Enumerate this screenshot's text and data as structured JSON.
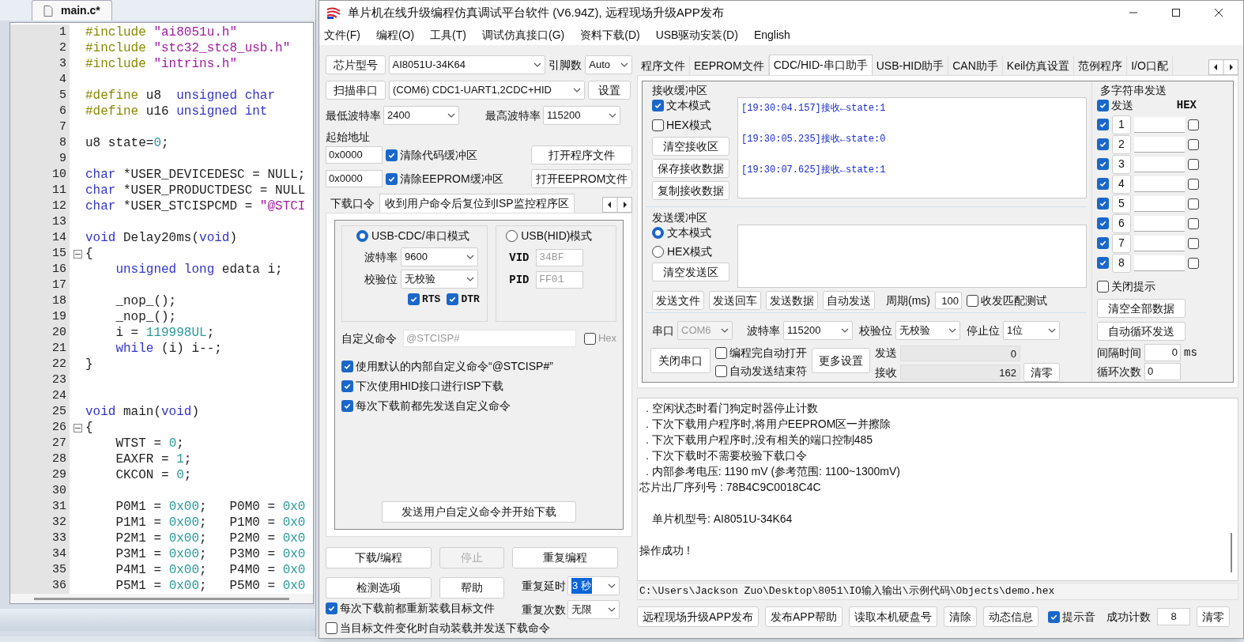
{
  "editor": {
    "tab": "main.c*",
    "lines": [
      {
        "number": "1",
        "fold": false,
        "tokens": [
          {
            "kind": "preproc",
            "text": "#include"
          },
          {
            "kind": "string",
            "text": " \"ai8051u.h\""
          }
        ]
      },
      {
        "number": "2",
        "fold": false,
        "tokens": [
          {
            "kind": "preproc",
            "text": "#include"
          },
          {
            "kind": "string",
            "text": " \"stc32_stc8_usb.h\""
          }
        ]
      },
      {
        "number": "3",
        "fold": false,
        "tokens": [
          {
            "kind": "preproc",
            "text": "#include"
          },
          {
            "kind": "string",
            "text": " \"intrins.h\""
          }
        ]
      },
      {
        "number": "4",
        "fold": false
      },
      {
        "number": "5",
        "fold": false,
        "tokens": [
          {
            "kind": "preproc",
            "text": "#define"
          },
          {
            "kind": "plain",
            "text": " u8  "
          },
          {
            "kind": "keyword",
            "text": "unsigned char"
          }
        ]
      },
      {
        "number": "6",
        "fold": false,
        "tokens": [
          {
            "kind": "preproc",
            "text": "#define"
          },
          {
            "kind": "plain",
            "text": " u16 "
          },
          {
            "kind": "keyword",
            "text": "unsigned int"
          }
        ]
      },
      {
        "number": "7",
        "fold": false
      },
      {
        "number": "8",
        "fold": false,
        "tokens": [
          {
            "kind": "plain",
            "text": "u8 state="
          },
          {
            "kind": "number",
            "text": "0"
          },
          {
            "kind": "plain",
            "text": ";"
          }
        ]
      },
      {
        "number": "9",
        "fold": false
      },
      {
        "number": "10",
        "fold": false,
        "tokens": [
          {
            "kind": "keyword",
            "text": "char"
          },
          {
            "kind": "plain",
            "text": " *USER_DEVICEDESC = NULL;"
          }
        ]
      },
      {
        "number": "11",
        "fold": false,
        "tokens": [
          {
            "kind": "keyword",
            "text": "char"
          },
          {
            "kind": "plain",
            "text": " *USER_PRODUCTDESC = NULL"
          }
        ]
      },
      {
        "number": "12",
        "fold": false,
        "tokens": [
          {
            "kind": "keyword",
            "text": "char"
          },
          {
            "kind": "plain",
            "text": " *USER_STCISPCMD = "
          },
          {
            "kind": "string",
            "text": "\"@STCI"
          }
        ]
      },
      {
        "number": "13",
        "fold": false
      },
      {
        "number": "14",
        "fold": false,
        "tokens": [
          {
            "kind": "keyword",
            "text": "void"
          },
          {
            "kind": "plain",
            "text": " Delay20ms("
          },
          {
            "kind": "keyword",
            "text": "void"
          },
          {
            "kind": "plain",
            "text": ")"
          }
        ]
      },
      {
        "number": "15",
        "fold": true,
        "tokens": [
          {
            "kind": "plain",
            "text": "{"
          }
        ]
      },
      {
        "number": "16",
        "fold": false,
        "tokens": [
          {
            "kind": "keyword",
            "text": "    unsigned long"
          },
          {
            "kind": "plain",
            "text": " edata i;"
          }
        ]
      },
      {
        "number": "17",
        "fold": false
      },
      {
        "number": "18",
        "fold": false,
        "tokens": [
          {
            "kind": "plain",
            "text": "    _nop_();"
          }
        ]
      },
      {
        "number": "19",
        "fold": false,
        "tokens": [
          {
            "kind": "plain",
            "text": "    _nop_();"
          }
        ]
      },
      {
        "number": "20",
        "fold": false,
        "tokens": [
          {
            "kind": "plain",
            "text": "    i = "
          },
          {
            "kind": "number",
            "text": "119998UL"
          },
          {
            "kind": "plain",
            "text": ";"
          }
        ]
      },
      {
        "number": "21",
        "fold": false,
        "tokens": [
          {
            "kind": "keyword",
            "text": "    while"
          },
          {
            "kind": "plain",
            "text": " (i) i--;"
          }
        ]
      },
      {
        "number": "22",
        "fold": false,
        "tokens": [
          {
            "kind": "plain",
            "text": "}"
          }
        ]
      },
      {
        "number": "23",
        "fold": false
      },
      {
        "number": "24",
        "fold": false
      },
      {
        "number": "25",
        "fold": false,
        "tokens": [
          {
            "kind": "keyword",
            "text": "void"
          },
          {
            "kind": "plain",
            "text": " main("
          },
          {
            "kind": "keyword",
            "text": "void"
          },
          {
            "kind": "plain",
            "text": ")"
          }
        ]
      },
      {
        "number": "26",
        "fold": true,
        "tokens": [
          {
            "kind": "plain",
            "text": "{"
          }
        ]
      },
      {
        "number": "27",
        "fold": false,
        "tokens": [
          {
            "kind": "plain",
            "text": "    WTST = "
          },
          {
            "kind": "number",
            "text": "0"
          },
          {
            "kind": "plain",
            "text": ";"
          }
        ]
      },
      {
        "number": "28",
        "fold": false,
        "tokens": [
          {
            "kind": "plain",
            "text": "    EAXFR = "
          },
          {
            "kind": "number",
            "text": "1"
          },
          {
            "kind": "plain",
            "text": ";"
          }
        ]
      },
      {
        "number": "29",
        "fold": false,
        "tokens": [
          {
            "kind": "plain",
            "text": "    CKCON = "
          },
          {
            "kind": "number",
            "text": "0"
          },
          {
            "kind": "plain",
            "text": ";"
          }
        ]
      },
      {
        "number": "30",
        "fold": false
      },
      {
        "number": "31",
        "fold": false,
        "tokens": [
          {
            "kind": "plain",
            "text": "    P0M1 = "
          },
          {
            "kind": "number",
            "text": "0x00"
          },
          {
            "kind": "plain",
            "text": ";   P0M0 = "
          },
          {
            "kind": "number",
            "text": "0x0"
          }
        ]
      },
      {
        "number": "32",
        "fold": false,
        "tokens": [
          {
            "kind": "plain",
            "text": "    P1M1 = "
          },
          {
            "kind": "number",
            "text": "0x00"
          },
          {
            "kind": "plain",
            "text": ";   P1M0 = "
          },
          {
            "kind": "number",
            "text": "0x0"
          }
        ]
      },
      {
        "number": "33",
        "fold": false,
        "tokens": [
          {
            "kind": "plain",
            "text": "    P2M1 = "
          },
          {
            "kind": "number",
            "text": "0x00"
          },
          {
            "kind": "plain",
            "text": ";   P2M0 = "
          },
          {
            "kind": "number",
            "text": "0x0"
          }
        ]
      },
      {
        "number": "34",
        "fold": false,
        "tokens": [
          {
            "kind": "plain",
            "text": "    P3M1 = "
          },
          {
            "kind": "number",
            "text": "0x00"
          },
          {
            "kind": "plain",
            "text": ";   P3M0 = "
          },
          {
            "kind": "number",
            "text": "0x0"
          }
        ]
      },
      {
        "number": "35",
        "fold": false,
        "tokens": [
          {
            "kind": "plain",
            "text": "    P4M1 = "
          },
          {
            "kind": "number",
            "text": "0x00"
          },
          {
            "kind": "plain",
            "text": ";   P4M0 = "
          },
          {
            "kind": "number",
            "text": "0x0"
          }
        ]
      },
      {
        "number": "36",
        "fold": false,
        "tokens": [
          {
            "kind": "plain",
            "text": "    P5M1 = "
          },
          {
            "kind": "number",
            "text": "0x00"
          },
          {
            "kind": "plain",
            "text": ";   P5M0 = "
          },
          {
            "kind": "number",
            "text": "0x0"
          }
        ]
      }
    ]
  },
  "window": {
    "title": "单片机在线升级编程仿真调试平台软件 (V6.94Z), 远程现场升级APP发布",
    "menu": [
      "文件(F)",
      "编程(O)",
      "工具(T)",
      "调试仿真接口(G)",
      "资料下载(D)",
      "USB驱动安装(D)",
      "English"
    ]
  },
  "left_panel": {
    "chip": {
      "button": "芯片型号",
      "value": "AI8051U-34K64",
      "pins_label": "引脚数",
      "pins_value": "Auto"
    },
    "port": {
      "button": "扫描串口",
      "value": "(COM6) CDC1-UART1,2CDC+HID",
      "settings": "设置"
    },
    "baud": {
      "min_label": "最低波特率",
      "min_value": "2400",
      "max_label": "最高波特率",
      "max_value": "115200"
    },
    "address_label": "起始地址",
    "address_rows": [
      {
        "value": "0x0000",
        "checkbox": {
          "label": "清除代码缓冲区",
          "checked": true
        },
        "button": "打开程序文件"
      },
      {
        "value": "0x0000",
        "checkbox": {
          "label": "清除EEPROM缓冲区",
          "checked": true
        },
        "button": "打开EEPROM文件"
      }
    ],
    "tabs": [
      {
        "label": "下载口令",
        "selected": false
      },
      {
        "label": "收到用户命令后复位到ISP监控程序区",
        "selected": true
      }
    ],
    "modes": [
      {
        "label": "USB-CDC/串口模式",
        "selected": true
      },
      {
        "label": "USB(HID)模式",
        "selected": false
      }
    ],
    "cdc": {
      "baud_label": "波特率",
      "baud": "9600",
      "parity_label": "校验位",
      "parity": "无校验",
      "flags": [
        {
          "label": "RTS",
          "checked": true
        },
        {
          "label": "DTR",
          "checked": true
        }
      ]
    },
    "hid": {
      "vid_label": "VID",
      "vid": "34BF",
      "pid_label": "PID",
      "pid": "FF01"
    },
    "custom_command": {
      "label": "自定义命令",
      "placeholder": "@STCISP#",
      "hex": {
        "label": "Hex",
        "checked": false
      }
    },
    "options": [
      {
        "label": "使用默认的内部自定义命令“@STCISP#”",
        "checked": true
      },
      {
        "label": "下次使用HID接口进行ISP下载",
        "checked": true
      },
      {
        "label": "每次下载前都先发送自定义命令",
        "checked": true
      }
    ],
    "send_button": "发送用户自定义命令并开始下载",
    "actions": [
      {
        "label": "下载/编程",
        "disabled": false
      },
      {
        "label": "停止",
        "disabled": true
      },
      {
        "label": "重复编程",
        "disabled": false
      },
      {
        "label": "检测选项",
        "disabled": false
      },
      {
        "label": "帮助",
        "disabled": false
      }
    ],
    "repeat_delay": {
      "label": "重复延时",
      "value": "3 秒"
    },
    "repeat_count": {
      "label": "重复次数",
      "value": "无限"
    },
    "bottom_checks": [
      {
        "label": "每次下载前都重新装载目标文件",
        "checked": true
      },
      {
        "label": "当目标文件变化时自动装载并发送下载命令",
        "checked": false
      }
    ]
  },
  "right_panel": {
    "tabs": [
      {
        "label": "程序文件",
        "selected": false
      },
      {
        "label": "EEPROM文件",
        "selected": false
      },
      {
        "label": "CDC/HID-串口助手",
        "selected": true
      },
      {
        "label": "USB-HID助手",
        "selected": false
      },
      {
        "label": "CAN助手",
        "selected": false
      },
      {
        "label": "Keil仿真设置",
        "selected": false
      },
      {
        "label": "范例程序",
        "selected": false
      },
      {
        "label": "I/O口配",
        "selected": false
      }
    ],
    "receive": {
      "title": "接收缓冲区",
      "modes": [
        {
          "label": "文本模式",
          "checked": true
        },
        {
          "label": "HEX模式",
          "checked": false
        }
      ],
      "buttons": [
        "清空接收区",
        "保存接收数据",
        "复制接收数据"
      ],
      "log": [
        "[19:30:04.157]接收←state:1",
        "[19:30:05.235]接收←state:0",
        "[19:30:07.625]接收←state:1"
      ]
    },
    "send": {
      "title": "发送缓冲区",
      "modes": [
        {
          "label": "文本模式",
          "selected": true
        },
        {
          "label": "HEX模式",
          "selected": false
        }
      ],
      "clear": "清空发送区",
      "buttons": [
        "发送文件",
        "发送回车",
        "发送数据",
        "自动发送"
      ],
      "period_label": "周期(ms)",
      "period": "100",
      "match": {
        "label": "收发匹配测试",
        "checked": false
      }
    },
    "serial": {
      "port_label": "串口",
      "port": "COM6",
      "baud_label": "波特率",
      "baud": "115200",
      "parity_label": "校验位",
      "parity": "无校验",
      "stop_label": "停止位",
      "stop": "1位",
      "close": "关闭串口",
      "checks": [
        {
          "label": "编程完自动打开",
          "checked": false
        },
        {
          "label": "自动发送结束符",
          "checked": false
        }
      ],
      "more": "更多设置",
      "sent_label": "发送",
      "sent": "0",
      "received_label": "接收",
      "received": "162",
      "clear": "清零"
    },
    "multi": {
      "title": "多字符串发送",
      "send": {
        "label": "发送",
        "checked": true
      },
      "hex_label": "HEX",
      "rows": [
        {
          "label": "1",
          "checked": true,
          "hex": false
        },
        {
          "label": "2",
          "checked": true,
          "hex": false
        },
        {
          "label": "3",
          "checked": true,
          "hex": false
        },
        {
          "label": "4",
          "checked": true,
          "hex": false
        },
        {
          "label": "5",
          "checked": true,
          "hex": false
        },
        {
          "label": "6",
          "checked": true,
          "hex": false
        },
        {
          "label": "7",
          "checked": true,
          "hex": false
        },
        {
          "label": "8",
          "checked": true,
          "hex": false
        }
      ],
      "close_hint": {
        "label": "关闭提示",
        "checked": false
      },
      "buttons": [
        "清空全部数据",
        "自动循环发送"
      ],
      "interval_label": "间隔时间",
      "interval": "0",
      "interval_unit": "ms",
      "loops_label": "循环次数",
      "loops": "0"
    },
    "output": [
      {
        "kind": "item",
        "text": ". 空闲状态时看门狗定时器停止计数"
      },
      {
        "kind": "item",
        "text": ". 下次下载用户程序时,将用户EEPROM区一并擦除"
      },
      {
        "kind": "item",
        "text": ". 下次下载用户程序时,没有相关的端口控制485"
      },
      {
        "kind": "item",
        "text": ". 下次下载时不需要校验下载口令"
      },
      {
        "kind": "item",
        "text": ". 内部参考电压: 1190 mV (参考范围: 1100~1300mV)"
      },
      {
        "kind": "plain",
        "text": "芯片出厂序列号 : 78B4C9C0018C4C"
      },
      {
        "kind": "sub",
        "text": "单片机型号: AI8051U-34K64"
      },
      {
        "kind": "result",
        "text": "操作成功 !"
      }
    ],
    "path": "C:\\Users\\Jackson Zuo\\Desktop\\8051\\IO输入输出\\示例代码\\Objects\\demo.hex",
    "bottom_buttons": [
      "远程现场升级APP发布",
      "发布APP帮助",
      "读取本机硬盘号",
      "清除",
      "动态信息"
    ],
    "sound": {
      "label": "提示音",
      "checked": true
    },
    "success_label": "成功计数",
    "success": "8",
    "reset": "清零"
  }
}
